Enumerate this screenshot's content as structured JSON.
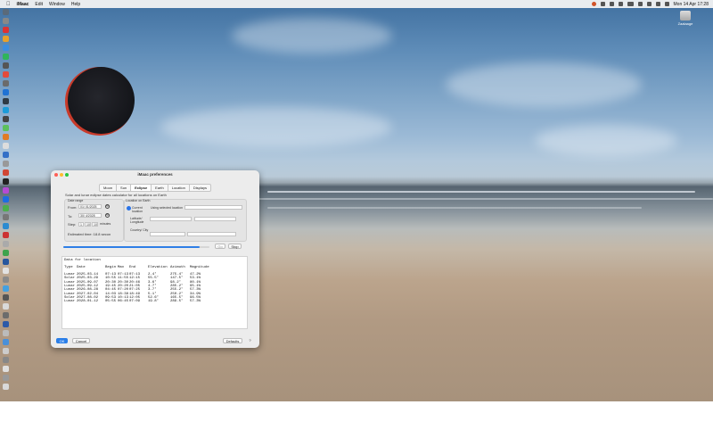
{
  "menubar": {
    "app_name": "iMaac",
    "items": [
      "Edit",
      "Window",
      "Help"
    ],
    "clock": "Mon 14 Apr  17:28"
  },
  "desktop": {
    "drive_label": "Zaalaage"
  },
  "window": {
    "title": "iMaac preferences",
    "tabs": [
      "Moon",
      "Sun",
      "Eclipse",
      "Earth",
      "Location",
      "Displays"
    ],
    "selected_tab": "Eclipse",
    "description": "Solar and lunar eclipse dates calculator for all locations on Earth",
    "date_range": {
      "group_label": "Date range",
      "from_label": "From:",
      "from_value": "01/ 01/2025",
      "to_label": "To:",
      "to_value": "30/ 4/2028",
      "step_label": "Step:",
      "step_value": "1",
      "step_sub": "10",
      "step_sub2": "10",
      "step_unit": "minutes",
      "estimated": "Estimated time: 18.8 secon"
    },
    "location": {
      "group_label": "Location on Earth",
      "current_label": "Current location",
      "selected_label": "Using selected location",
      "lat_label": "Latitude/ Longitude",
      "country_label": "Country/ City"
    },
    "progress": 0.93,
    "go_label": "Go",
    "stop_label": "Stop",
    "results": {
      "title": "Data for location",
      "headers": [
        "Type",
        "Date",
        "Begin",
        "Max",
        "End",
        "Elevation",
        "Azimuth",
        "Magnitude"
      ],
      "rows": [
        [
          "Lunar",
          "2025-03-14",
          "07:13",
          "07:13",
          "07:13",
          "2.4°",
          "275.4°",
          "47.2%"
        ],
        [
          "Solar",
          "2025-03-29",
          "10:55",
          "11:55",
          "12:15",
          "55.5°",
          "147.5°",
          "53.1%"
        ],
        [
          "Lunar",
          "2025-09-07",
          "20:30",
          "20:30",
          "20:46",
          "3.6°",
          "98.2°",
          "80.1%"
        ],
        [
          "Lunar",
          "2025-09-12",
          "19:45",
          "20:20",
          "21:05",
          "4.7°",
          "285.2°",
          "95.1%"
        ],
        [
          "Lunar",
          "2026-08-28",
          "04:45",
          "07:20",
          "07:25",
          "3.7°",
          "255.2°",
          "57.3%"
        ],
        [
          "Lunar",
          "2027-02-04",
          "14:03",
          "18:38",
          "18:49",
          "5.1°",
          "250.2°",
          "34.9%"
        ],
        [
          "Solar",
          "2027-08-02",
          "09:53",
          "10:13",
          "12:05",
          "52.6°",
          "165.5°",
          "96.5%"
        ],
        [
          "Lunar",
          "2028-01-12",
          "05:55",
          "06:45",
          "07:09",
          "19.8°",
          "289.5°",
          "57.3%"
        ]
      ]
    },
    "ok_label": "OK",
    "cancel_label": "Cancel",
    "defaults_label": "Defaults",
    "help_label": "?"
  }
}
